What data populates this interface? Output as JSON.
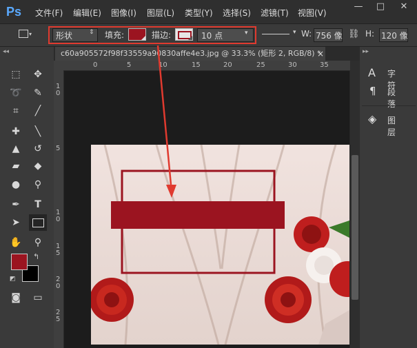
{
  "app": {
    "logo": "Ps"
  },
  "menu": [
    "文件(F)",
    "编辑(E)",
    "图像(I)",
    "图层(L)",
    "类型(Y)",
    "选择(S)",
    "滤镜(T)",
    "视图(V)"
  ],
  "window_controls": [
    "—",
    "□",
    "✕"
  ],
  "options": {
    "mode": "形状",
    "fill_label": "填充:",
    "fill_color": "#9b1420",
    "stroke_label": "描边:",
    "stroke_color": "#9b1420",
    "stroke_width": "10 点",
    "w_label": "W:",
    "w_value": "756 像",
    "h_label": "H:",
    "h_value": "120 像"
  },
  "document": {
    "tab_title": "c60a905572f98f33559a90830affe4e3.jpg @ 33.3% (矩形 2, RGB/8) *",
    "close": "×"
  },
  "ruler_top": [
    "0",
    "5",
    "10",
    "15",
    "20",
    "25",
    "30",
    "35"
  ],
  "ruler_left": [
    "1",
    "0",
    "5",
    "1",
    "0",
    "1",
    "5",
    "2",
    "0",
    "2",
    "5"
  ],
  "panels": [
    {
      "label": "字符",
      "icon": "character-icon"
    },
    {
      "label": "段落",
      "icon": "paragraph-icon"
    },
    {
      "label": "图层",
      "icon": "layers-icon"
    }
  ],
  "colors": {
    "foreground": "#9b1420",
    "background": "#000000",
    "shape_fill": "#9b1420",
    "annotation": "#e03a2f"
  }
}
